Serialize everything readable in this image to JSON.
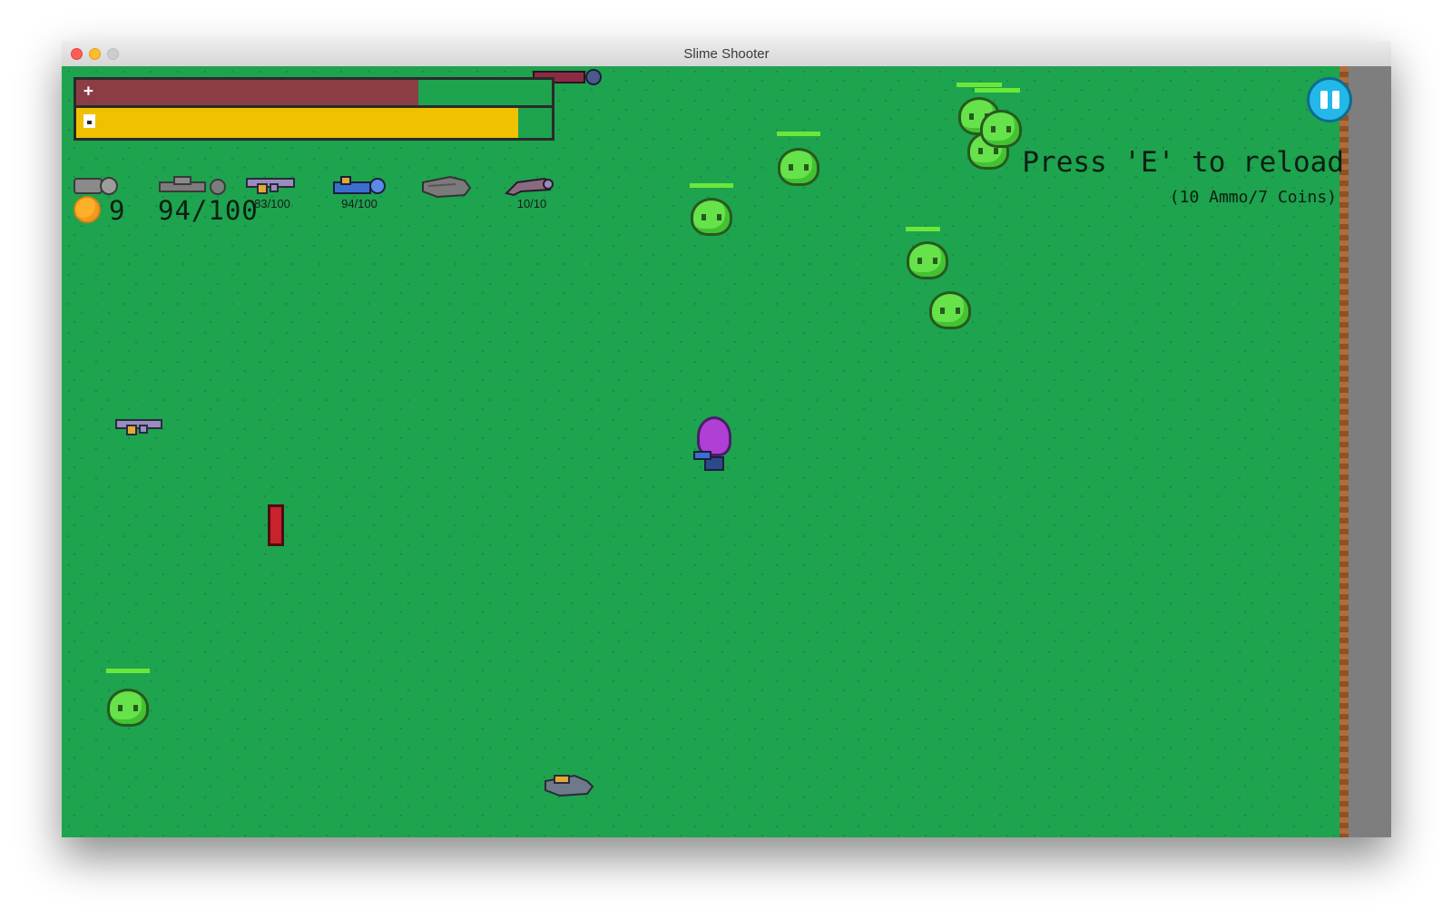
{
  "window": {
    "title": "Slime Shooter"
  },
  "hud": {
    "health": {
      "icon": "plus-icon",
      "fraction": 0.72,
      "color": "#8b3d45"
    },
    "energy": {
      "icon": "battery-icon",
      "fraction": 0.93,
      "color": "#efc100"
    },
    "weapons": [
      {
        "name": "cannon-weapon",
        "ammo": "",
        "color": "#8a8a8a"
      },
      {
        "name": "heavy-rifle-weapon",
        "ammo": "",
        "color": "#7c7c7c"
      },
      {
        "name": "blaster-weapon",
        "ammo": "83/100",
        "color": "#9a8cc0"
      },
      {
        "name": "plasma-rifle-weapon",
        "ammo": "94/100",
        "color": "#3a6fd0"
      },
      {
        "name": "minigun-weapon",
        "ammo": "",
        "color": "#7a7a7a"
      },
      {
        "name": "shotgun-weapon",
        "ammo": "10/10",
        "color": "#8a6a80"
      }
    ],
    "coins": "9",
    "ammo": "94/100",
    "reload_message": "Press 'E' to reload",
    "reload_cost": "(10 Ammo/7 Coins)",
    "pause_icon": "pause-icon"
  },
  "entities": {
    "slime_count": 9,
    "player": "purple-slime-player",
    "pickups": [
      "blaster-pickup",
      "minigun-pickup",
      "health-potion-pickup",
      "rifle-pickup"
    ]
  },
  "colors": {
    "grass": "#1ea34f",
    "slime": "#66e24a",
    "slime_hp": "#6ae83a",
    "coin": "#ffb02a",
    "pause": "#23b8e8"
  }
}
